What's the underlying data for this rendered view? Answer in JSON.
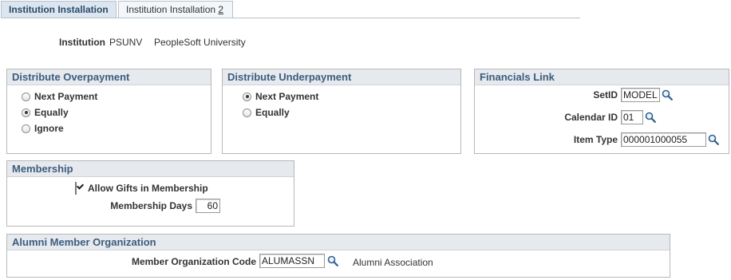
{
  "tabs": [
    {
      "label": "Institution Installation",
      "active": true
    },
    {
      "label_prefix": "Institution Installation ",
      "label_accesskey": "2",
      "active": false
    }
  ],
  "institution": {
    "label": "Institution",
    "code": "PSUNV",
    "description": "PeopleSoft University"
  },
  "distribute_overpayment": {
    "title": "Distribute Overpayment",
    "options": [
      {
        "label": "Next Payment",
        "selected": false
      },
      {
        "label": "Equally",
        "selected": true
      },
      {
        "label": "Ignore",
        "selected": false
      }
    ]
  },
  "distribute_underpayment": {
    "title": "Distribute Underpayment",
    "options": [
      {
        "label": "Next Payment",
        "selected": true
      },
      {
        "label": "Equally",
        "selected": false
      }
    ]
  },
  "financials_link": {
    "title": "Financials Link",
    "setid_label": "SetID",
    "setid_value": "MODEL",
    "calendar_label": "Calendar ID",
    "calendar_value": "01",
    "item_type_label": "Item Type",
    "item_type_value": "000001000055"
  },
  "membership": {
    "title": "Membership",
    "allow_gifts_label": "Allow Gifts in Membership",
    "allow_gifts_checked": true,
    "days_label": "Membership Days",
    "days_value": "60"
  },
  "alumni": {
    "title": "Alumni Member Organization",
    "code_label": "Member Organization Code",
    "code_value": "ALUMASSN",
    "description": "Alumni Association"
  },
  "colors": {
    "group_header_text": "#3d5d7c",
    "group_header_bg": "#e6e9ed",
    "active_tab_bg": "#dbe6f0"
  },
  "icons": {
    "lookup": "magnifier-icon"
  }
}
